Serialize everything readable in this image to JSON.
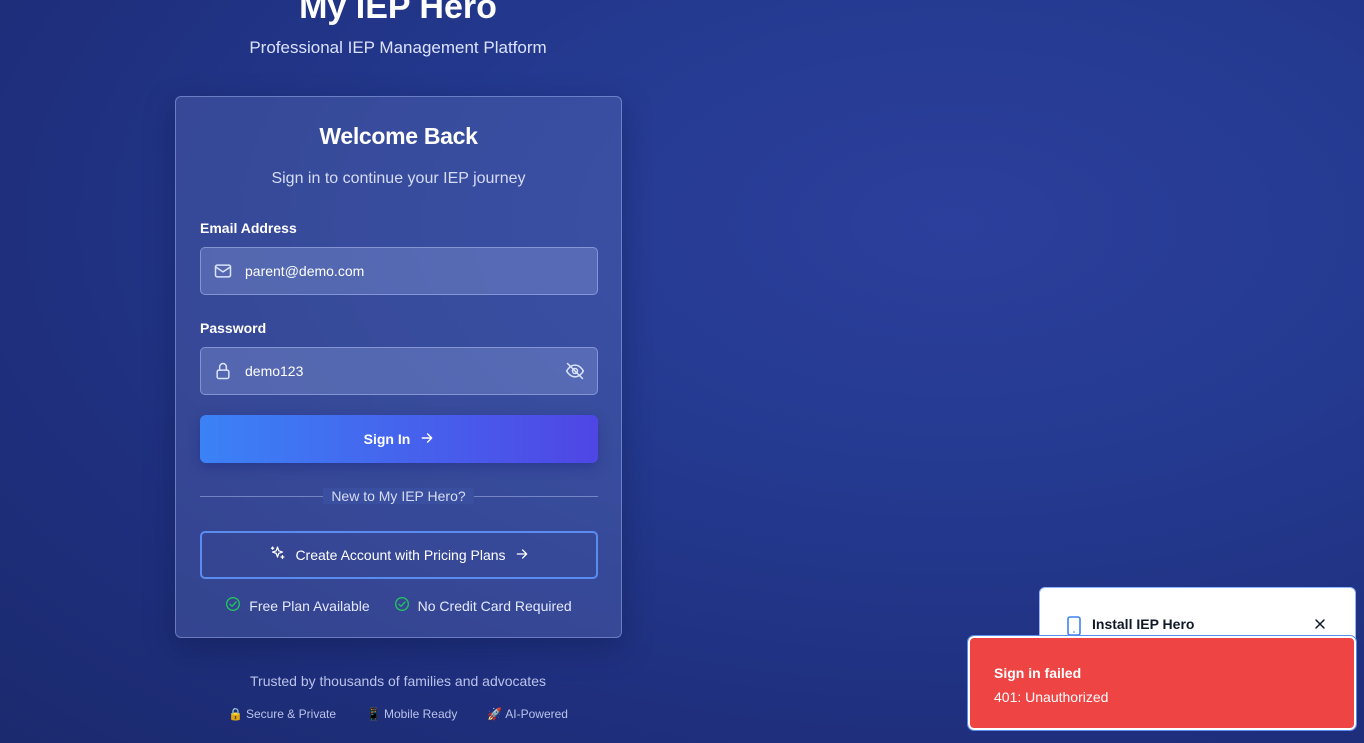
{
  "brand": {
    "title": "My IEP Hero",
    "subtitle": "Professional IEP Management Platform"
  },
  "card": {
    "title": "Welcome Back",
    "subtitle": "Sign in to continue your IEP journey",
    "email": {
      "label": "Email Address",
      "value": "parent@demo.com",
      "icon": "mail-icon"
    },
    "password": {
      "label": "Password",
      "value": "demo123",
      "icon": "lock-icon",
      "toggle_icon": "eye-off-icon"
    },
    "signin_label": "Sign In",
    "divider_text": "New to My IEP Hero?",
    "create_label": "Create Account with Pricing Plans",
    "perks": [
      "Free Plan Available",
      "No Credit Card Required"
    ]
  },
  "footer": {
    "trusted": "Trusted by thousands of families and advocates",
    "badges": [
      {
        "emoji": "🔒",
        "label": "Secure & Private"
      },
      {
        "emoji": "📱",
        "label": "Mobile Ready"
      },
      {
        "emoji": "🚀",
        "label": "AI-Powered"
      }
    ]
  },
  "install_prompt": {
    "label": "Install IEP Hero"
  },
  "toast": {
    "title": "Sign in failed",
    "message": "401: Unauthorized"
  },
  "colors": {
    "toast_bg": "#ef4444",
    "button_start": "#3b82f6",
    "button_end": "#4f46e5",
    "check": "#22c55e"
  }
}
